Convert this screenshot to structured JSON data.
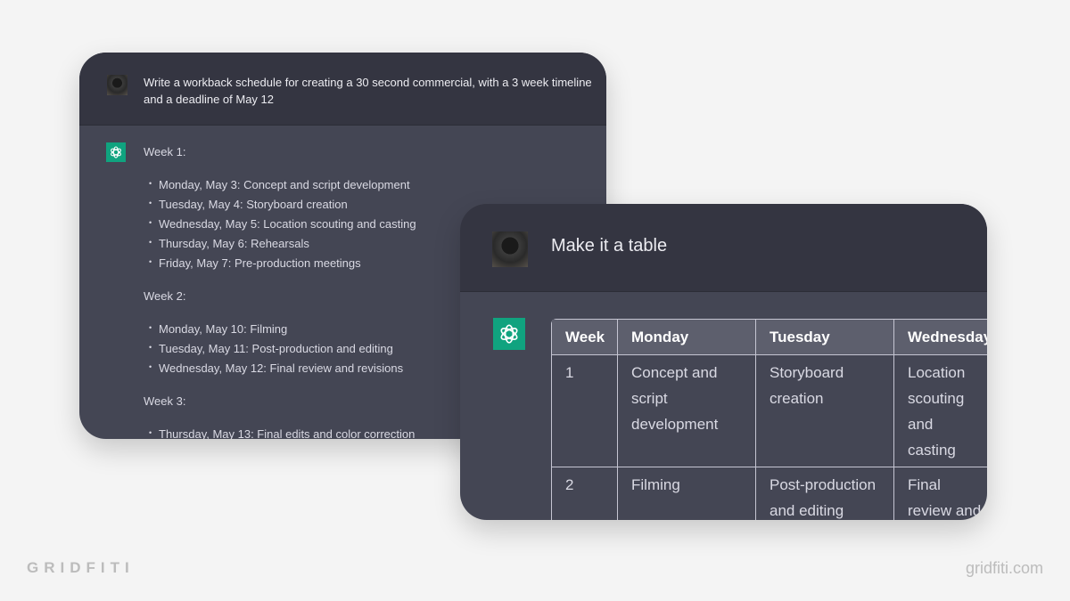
{
  "chat1": {
    "prompt": "Write a workback schedule for creating a 30 second commercial, with a 3 week timeline and a deadline of May 12",
    "weeks": [
      {
        "title": "Week 1:",
        "items": [
          "Monday, May 3: Concept and script development",
          "Tuesday, May 4: Storyboard creation",
          "Wednesday, May 5: Location scouting and casting",
          "Thursday, May 6: Rehearsals",
          "Friday, May 7: Pre-production meetings"
        ]
      },
      {
        "title": "Week 2:",
        "items": [
          "Monday, May 10: Filming",
          "Tuesday, May 11: Post-production and editing",
          "Wednesday, May 12: Final review and revisions"
        ]
      },
      {
        "title": "Week 3:",
        "items": [
          "Thursday, May 13: Final edits and color correction"
        ]
      }
    ]
  },
  "chat2": {
    "prompt": "Make it a table",
    "headers": [
      "Week",
      "Monday",
      "Tuesday",
      "Wednesday"
    ],
    "rows": [
      [
        "1",
        "Concept and script development",
        "Storyboard creation",
        "Location scouting and casting"
      ],
      [
        "2",
        "Filming",
        "Post-production and editing",
        "Final review and revisions"
      ]
    ]
  },
  "brand": {
    "logo": "GRIDFITI",
    "url": "gridfiti.com"
  },
  "colors": {
    "accent": "#10a37f",
    "user_bg": "#343541",
    "assistant_bg": "#444654"
  }
}
